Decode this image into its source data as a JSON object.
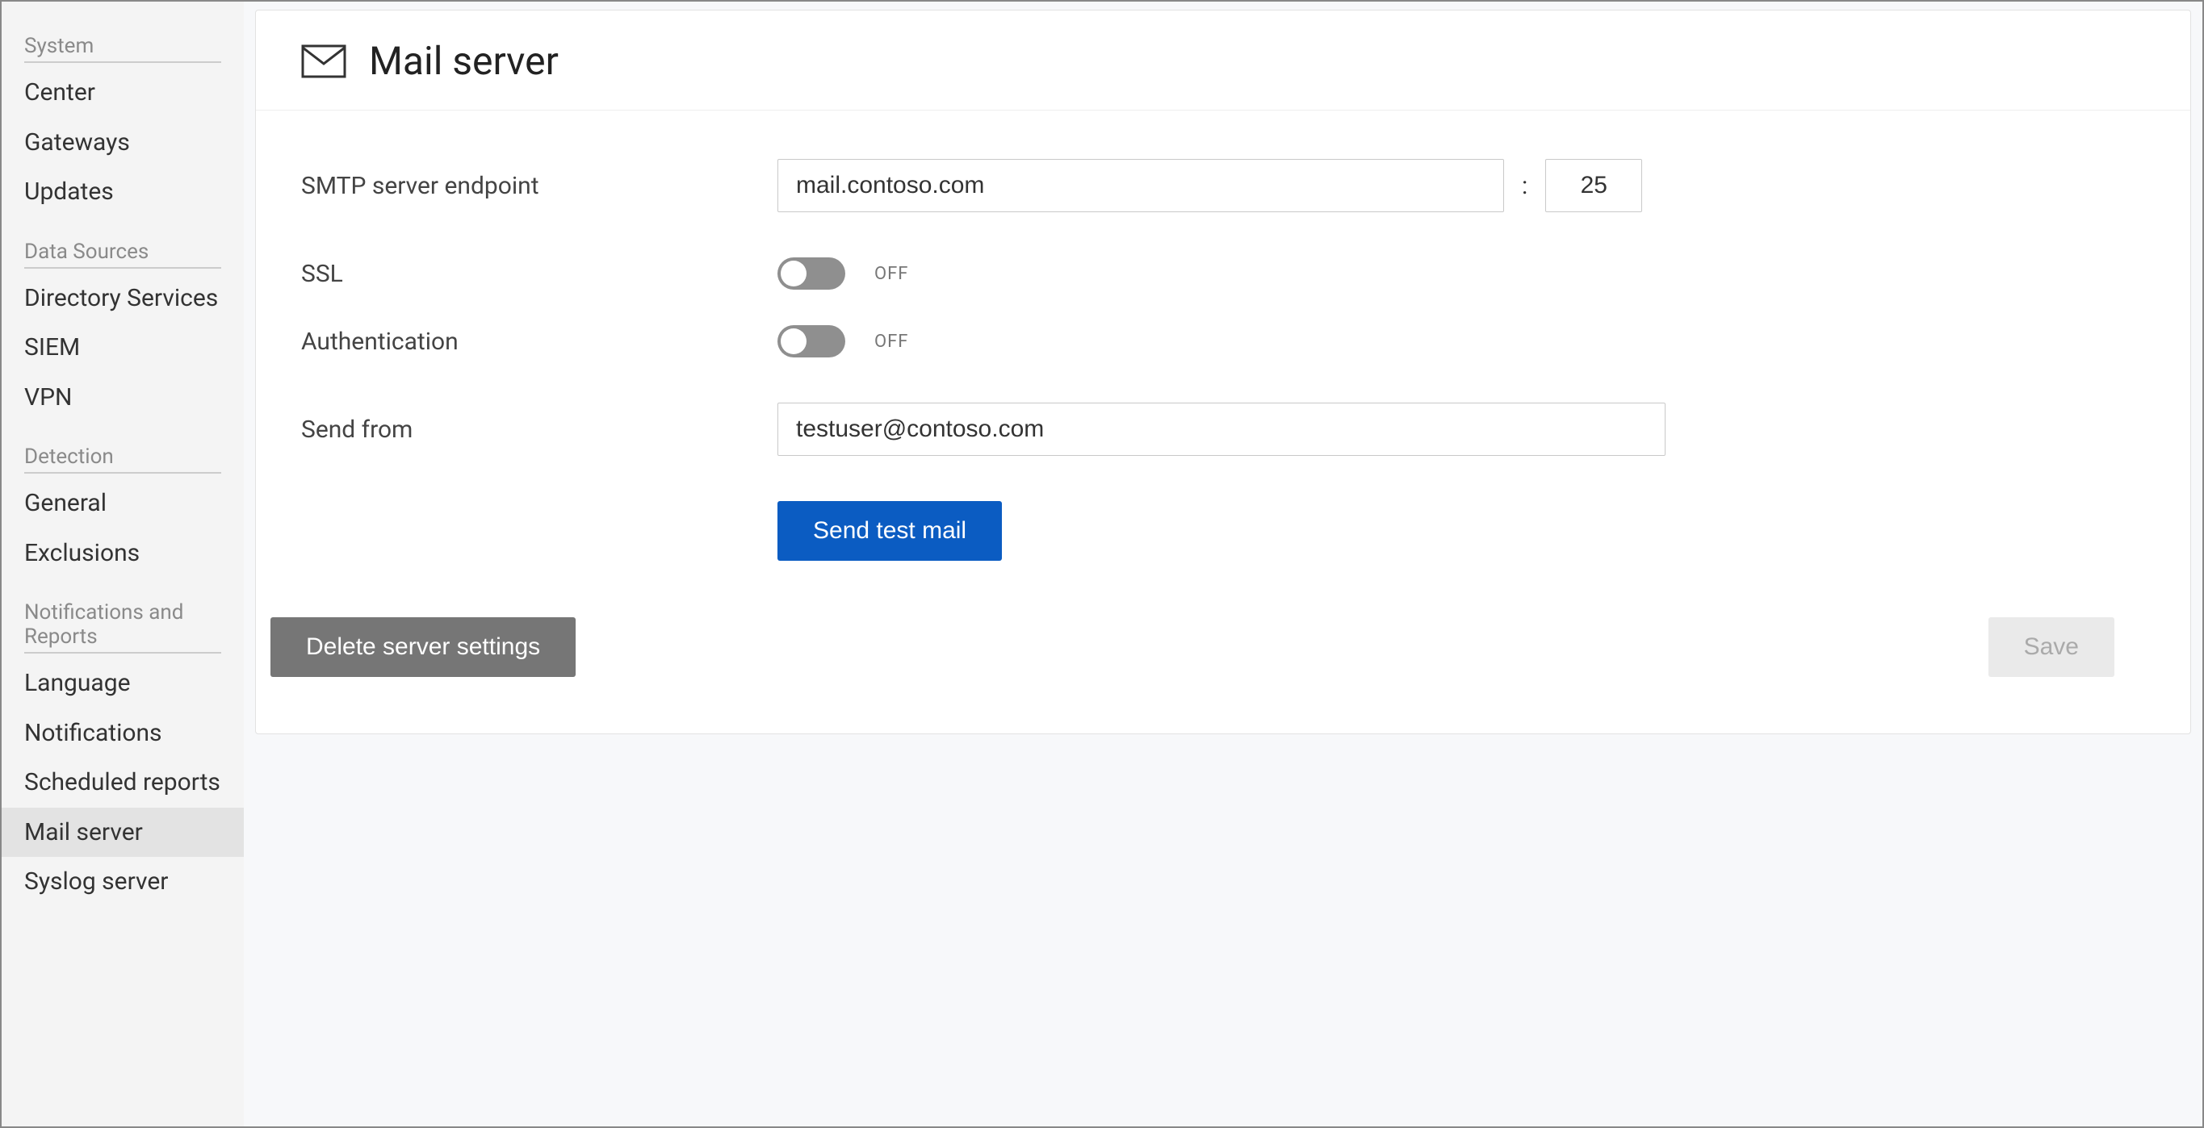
{
  "sidebar": {
    "sections": [
      {
        "header": "System",
        "items": [
          "Center",
          "Gateways",
          "Updates"
        ]
      },
      {
        "header": "Data Sources",
        "items": [
          "Directory Services",
          "SIEM",
          "VPN"
        ]
      },
      {
        "header": "Detection",
        "items": [
          "General",
          "Exclusions"
        ]
      },
      {
        "header": "Notifications and Reports",
        "items": [
          "Language",
          "Notifications",
          "Scheduled reports",
          "Mail server",
          "Syslog server"
        ]
      }
    ],
    "active": "Mail server"
  },
  "page": {
    "title": "Mail server"
  },
  "form": {
    "endpoint_label": "SMTP server endpoint",
    "endpoint_value": "mail.contoso.com",
    "colon": ":",
    "port_value": "25",
    "ssl_label": "SSL",
    "ssl_state": "OFF",
    "auth_label": "Authentication",
    "auth_state": "OFF",
    "sendfrom_label": "Send from",
    "sendfrom_value": "testuser@contoso.com"
  },
  "buttons": {
    "send_test": "Send test mail",
    "delete_settings": "Delete server settings",
    "save": "Save"
  }
}
